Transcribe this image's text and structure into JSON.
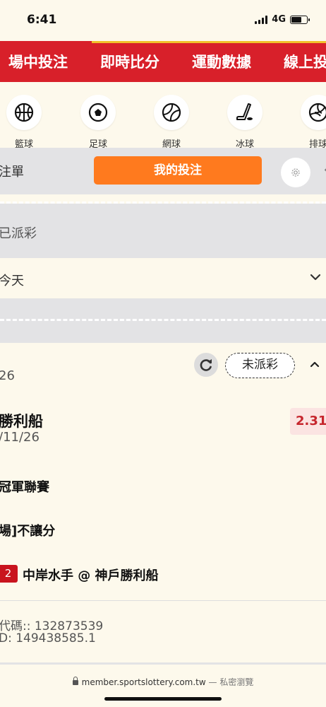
{
  "status_bar": {
    "time": "6:41",
    "network": "4G",
    "battery_level": 0.7
  },
  "nav_tabs": [
    "場中投注",
    "即時比分",
    "運動數據",
    "線上投"
  ],
  "sports": [
    {
      "label": "籃球",
      "icon": "basketball-icon"
    },
    {
      "label": "足球",
      "icon": "soccer-ball-icon"
    },
    {
      "label": "網球",
      "icon": "tennis-ball-icon"
    },
    {
      "label": "冰球",
      "icon": "ice-hockey-icon"
    },
    {
      "label": "排球",
      "icon": "volleyball-icon"
    }
  ],
  "bet_bar": {
    "left_label": "注單",
    "my_bets_label": "我的投注",
    "settings_icon": "gear-icon"
  },
  "filters": {
    "settled_label": "已派彩",
    "period_label": "今天"
  },
  "bet_card": {
    "status": "未派彩",
    "date_top": "26",
    "team": "勝利船",
    "odds": "2.31",
    "date": "/11/26",
    "league": "冠軍聯賽",
    "market": "場]不讓分",
    "score_badge": "2",
    "matchup": "中岸水手 @ 神戶勝利船",
    "code_line1": "代碼:: 132873539",
    "code_line2": "D: 149438585.1"
  },
  "url_bar": {
    "url": "member.sportslottery.com.tw",
    "separator": " — ",
    "mode": "私密瀏覽"
  },
  "colors": {
    "nav_red": "#d8202a",
    "accent_orange": "#ff7a1e",
    "odds_red": "#c6262d",
    "background": "#fdf9ec"
  }
}
